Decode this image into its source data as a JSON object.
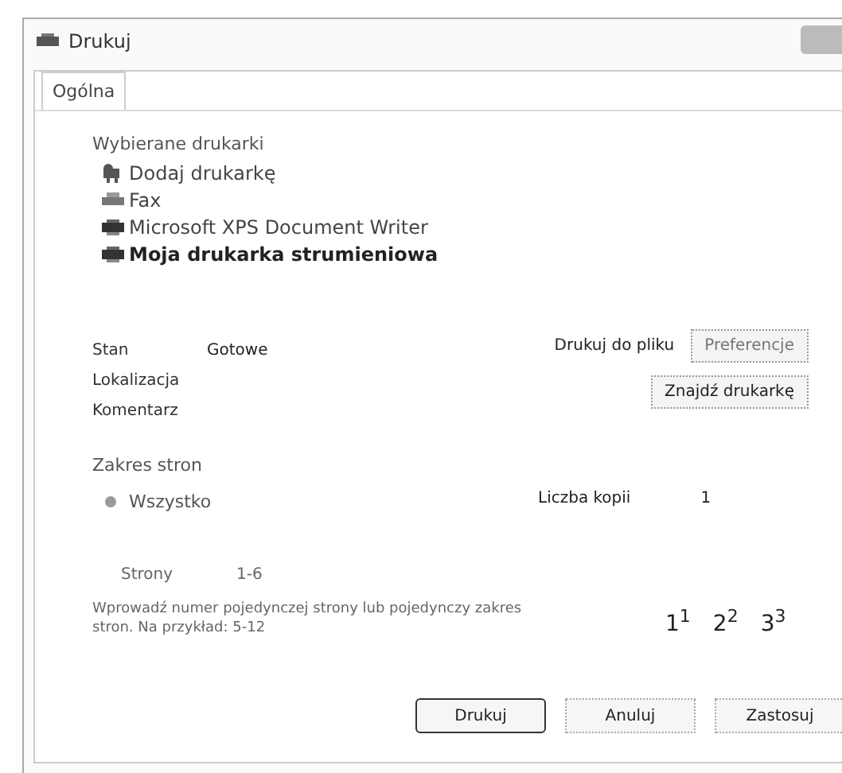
{
  "window": {
    "title": "Drukuj"
  },
  "tabs": [
    {
      "label": "Ogólna",
      "selected": true
    }
  ],
  "printers": {
    "label": "Wybierane drukarki",
    "items": [
      {
        "name": "Dodaj drukarkę",
        "kind": "add",
        "selected": false
      },
      {
        "name": "Fax",
        "kind": "fax",
        "selected": false
      },
      {
        "name": "Microsoft XPS Document Writer",
        "kind": "printer",
        "selected": false
      },
      {
        "name": "Moja drukarka strumieniowa",
        "kind": "printer",
        "selected": true
      }
    ]
  },
  "info": [
    {
      "label": "Stan",
      "value": "Gotowe"
    },
    {
      "label": "Lokalizacja"
    },
    {
      "label": "Komentarz"
    }
  ],
  "print_to_file": {
    "label": "Drukuj do pliku"
  },
  "preferences_button": "Preferencje",
  "find_printer_button": "Znajdź drukarkę",
  "page_range": {
    "label": "Zakres stron",
    "all": {
      "label": "Wszystko",
      "selected": true
    },
    "pages": {
      "label": "Strony",
      "value": "1-6"
    },
    "hint": "Wprowadź numer pojedynczej strony lub pojedynczy zakres stron. Na przykład: 5-12"
  },
  "copies": {
    "label": "Liczba kopii",
    "value": "1",
    "collate_pages": [
      "1",
      "1",
      "2",
      "2",
      "3",
      "3"
    ]
  },
  "buttons": [
    {
      "label": "Drukuj",
      "kind": "default"
    },
    {
      "label": "Anuluj",
      "kind": "normal"
    },
    {
      "label": "Zastosuj",
      "kind": "normal"
    }
  ]
}
